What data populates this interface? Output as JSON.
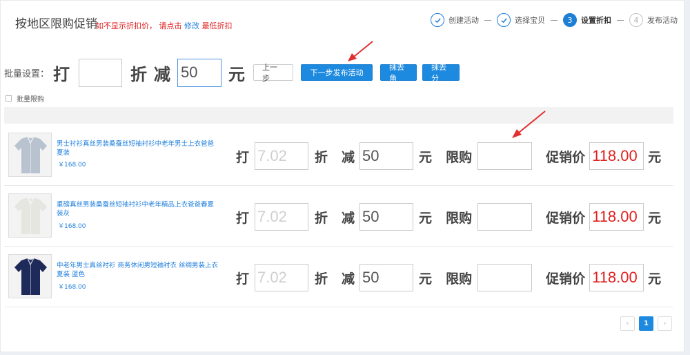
{
  "page": {
    "title": "按地区限购促销",
    "hint_prefix": "如不显示折扣价， 请点击 ",
    "hint_link": "修改",
    "hint_suffix": " 最低折扣"
  },
  "steps": [
    {
      "num": "",
      "label": "创建活动",
      "state": "done"
    },
    {
      "num": "",
      "label": "选择宝贝",
      "state": "done"
    },
    {
      "num": "3",
      "label": "设置折扣",
      "state": "active"
    },
    {
      "num": "4",
      "label": "发布活动",
      "state": "todo"
    }
  ],
  "batch": {
    "label": "批量设置：",
    "da": "打",
    "discount_value": "",
    "zhe": "折",
    "jian": "减",
    "reduce_value": "50",
    "yuan": "元",
    "prev_label": "上一步",
    "next_label": "下一步发布活动",
    "round_jiao_label": "抹去角",
    "round_fen_label": "抹去分",
    "limit_label": "批量限购"
  },
  "row_labels": {
    "da": "打",
    "zhe": "折",
    "jian": "减",
    "yuan": "元",
    "limit": "限购",
    "promo_price": "促销价"
  },
  "products": [
    {
      "name": "男士衬衫真丝男装桑蚕丝短袖衬衫中老年男士上衣爸爸夏装",
      "price": "￥168.00",
      "discount": "7.02",
      "reduce": "50",
      "limit": "",
      "promo_price": "118.00",
      "shirt_color": "#b9c3cf"
    },
    {
      "name": "重磅真丝男装桑蚕丝短袖衬衫中老年精品上衣爸爸春夏装灰",
      "price": "￥168.00",
      "discount": "7.02",
      "reduce": "50",
      "limit": "",
      "promo_price": "118.00",
      "shirt_color": "#e4e6df"
    },
    {
      "name": "中老年男士真丝衬衫 商务休闲男短袖衬衣 丝绸男装上衣 夏装 蓝色",
      "price": "￥168.00",
      "discount": "7.02",
      "reduce": "50",
      "limit": "",
      "promo_price": "118.00",
      "shirt_color": "#1e2a5a"
    }
  ],
  "pagination": {
    "prev": "‹",
    "current": "1",
    "next": "›"
  },
  "colors": {
    "primary": "#1d8ae0",
    "link": "#1f7fdc",
    "hint_red": "#e02020",
    "promo_red": "#e02020",
    "arrow_red": "#e03030"
  }
}
